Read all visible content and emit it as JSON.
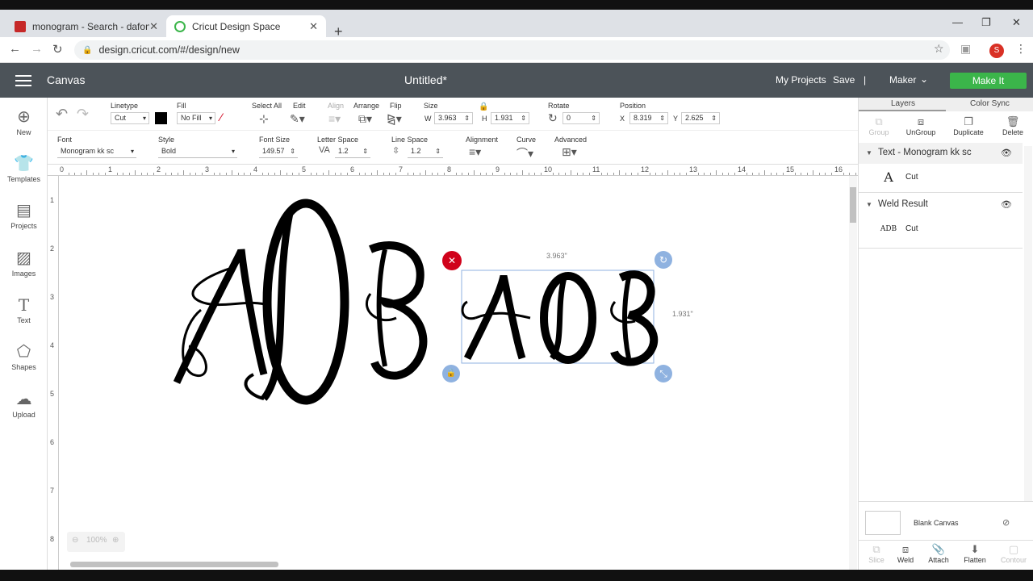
{
  "browser": {
    "tabs": [
      {
        "title": "monogram - Search - dafont.com",
        "active": false
      },
      {
        "title": "Cricut Design Space",
        "active": true
      }
    ],
    "new_tab": "+",
    "url": "design.cricut.com/#/design/new",
    "profile_initial": "S"
  },
  "header": {
    "section": "Canvas",
    "title": "Untitled*",
    "my_projects": "My Projects",
    "save": "Save",
    "separator": "|",
    "machine": "Maker",
    "make_it": "Make It"
  },
  "sidebar": [
    {
      "label": "New",
      "icon": "plus-circle-icon"
    },
    {
      "label": "Templates",
      "icon": "shirt-icon"
    },
    {
      "label": "Projects",
      "icon": "projects-icon"
    },
    {
      "label": "Images",
      "icon": "image-icon"
    },
    {
      "label": "Text",
      "icon": "text-icon"
    },
    {
      "label": "Shapes",
      "icon": "shapes-icon"
    },
    {
      "label": "Upload",
      "icon": "upload-cloud-icon"
    }
  ],
  "toolbar1": {
    "linetype_label": "Linetype",
    "linetype_value": "Cut",
    "fill_label": "Fill",
    "fill_value": "No Fill",
    "select_all": "Select All",
    "edit": "Edit",
    "align": "Align",
    "arrange": "Arrange",
    "flip": "Flip",
    "size_label": "Size",
    "w_label": "W",
    "w_value": "3.963",
    "h_label": "H",
    "h_value": "1.931",
    "rotate_label": "Rotate",
    "rotate_value": "0",
    "position_label": "Position",
    "x_label": "X",
    "x_value": "8.319",
    "y_label": "Y",
    "y_value": "2.625"
  },
  "toolbar2": {
    "font_label": "Font",
    "font_value": "Monogram kk sc",
    "style_label": "Style",
    "style_value": "Bold",
    "font_size_label": "Font Size",
    "font_size_value": "149.57",
    "letter_space_label": "Letter Space",
    "letter_space_value": "1.2",
    "line_space_label": "Line Space",
    "line_space_value": "1.2",
    "alignment_label": "Alignment",
    "curve_label": "Curve",
    "advanced_label": "Advanced"
  },
  "canvas": {
    "ruler_h": [
      "0",
      "1",
      "2",
      "3",
      "4",
      "5",
      "6",
      "7",
      "8",
      "9",
      "10",
      "11",
      "12",
      "13",
      "14",
      "15",
      "16"
    ],
    "ruler_v": [
      "1",
      "2",
      "3",
      "4",
      "5",
      "6",
      "7",
      "8"
    ],
    "width_dim": "3.963\"",
    "height_dim": "1.931\"",
    "monogram_text": "ADB",
    "zoom": "100%"
  },
  "layers_panel": {
    "tab_layers": "Layers",
    "tab_color_sync": "Color Sync",
    "actions": [
      {
        "label": "Group",
        "disabled": true
      },
      {
        "label": "UnGroup",
        "disabled": false
      },
      {
        "label": "Duplicate",
        "disabled": false
      },
      {
        "label": "Delete",
        "disabled": false
      }
    ],
    "groups": [
      {
        "name": "Text - Monogram kk sc",
        "item": "Cut",
        "thumb": "A"
      },
      {
        "name": "Weld Result",
        "item": "Cut",
        "thumb": "ADB"
      }
    ],
    "blank_canvas": "Blank Canvas",
    "bottom_actions": [
      {
        "label": "Slice",
        "disabled": true
      },
      {
        "label": "Weld",
        "disabled": false
      },
      {
        "label": "Attach",
        "disabled": false
      },
      {
        "label": "Flatten",
        "disabled": false
      },
      {
        "label": "Contour",
        "disabled": true
      }
    ]
  },
  "colors": {
    "header": "#4c5359",
    "make_it": "#3bb54a",
    "delete_handle": "#d0021b",
    "handle_blue": "#8fb2e0"
  }
}
